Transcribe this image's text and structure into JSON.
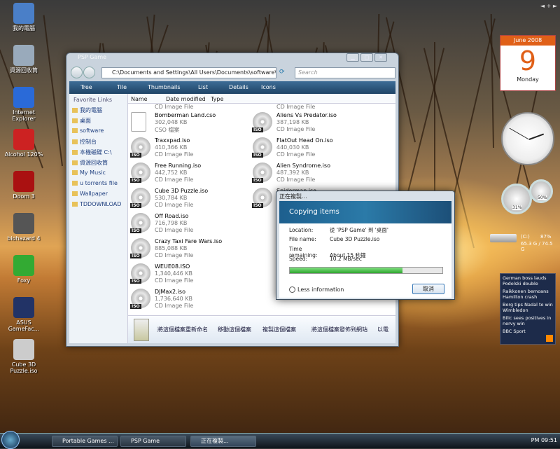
{
  "desktop_icons": [
    {
      "label": "我的電腦",
      "color": "#4a7fc8"
    },
    {
      "label": "資源回收筒",
      "color": "#9ab"
    },
    {
      "label": "Internet Explorer",
      "color": "#2a6ad8"
    },
    {
      "label": "Alcohol 120%",
      "color": "#c22"
    },
    {
      "label": "Doom 3",
      "color": "#a11"
    },
    {
      "label": "biohazard 4",
      "color": "#555"
    },
    {
      "label": "Foxy",
      "color": "#3a3"
    },
    {
      "label": "ASUS GameFac...",
      "color": "#236"
    },
    {
      "label": "Cube 3D Puzzle.iso",
      "color": "#ccc"
    }
  ],
  "window": {
    "title": "PSP Game",
    "path": "C:\\Documents and Settings\\All Users\\Documents\\software\\PSP",
    "search_placeholder": "Search",
    "toolbar": [
      "Tree",
      "Tile",
      "Thumbnails",
      "List",
      "Details",
      "Icons"
    ],
    "favorites_header": "Favorite Links",
    "favorites": [
      "我的電腦",
      "桌面",
      "software",
      "控制台",
      "本機磁碟 C:\\",
      "資源回收筒",
      "My Music",
      "u torrents file",
      "Wallpaper",
      "TDDOWNLOAD"
    ],
    "columns": [
      "Name",
      "Date modified",
      "Type"
    ],
    "left_files": [
      {
        "name": "Bomberman Land.cso",
        "size": "302,048 KB",
        "type": "CSO 檔案"
      },
      {
        "name": "Traxxpad.iso",
        "size": "410,366 KB",
        "type": "CD Image File"
      },
      {
        "name": "Free Running.iso",
        "size": "442,752 KB",
        "type": "CD Image File"
      },
      {
        "name": "Cube 3D Puzzle.iso",
        "size": "530,784 KB",
        "type": "CD Image File"
      },
      {
        "name": "Off Road.iso",
        "size": "716,798 KB",
        "type": "CD Image File"
      },
      {
        "name": "Crazy Taxi Fare Wars.iso",
        "size": "885,088 KB",
        "type": "CD Image File"
      },
      {
        "name": "WEUE08.ISO",
        "size": "1,340,446 KB",
        "type": "CD Image File"
      },
      {
        "name": "DJMax2.iso",
        "size": "1,736,640 KB",
        "type": "CD Image File"
      }
    ],
    "right_files": [
      {
        "name": "Aliens Vs Predator.iso",
        "size": "387,198 KB",
        "type": "CD Image File"
      },
      {
        "name": "FlatOut Head On.iso",
        "size": "440,030 KB",
        "type": "CD Image File"
      },
      {
        "name": "Alien Syndrome.iso",
        "size": "487,392 KB",
        "type": "CD Image File"
      },
      {
        "name": "Spiderman.iso",
        "size": "",
        "type": ""
      }
    ],
    "top_partial_left": "CD Image File",
    "top_partial_right": "CD Image File",
    "footer_actions": [
      "將這個檔案重新命名",
      "移動這個檔案",
      "複製這個檔案",
      "將這個檔案發佈到網站",
      "以電"
    ]
  },
  "copy_dialog": {
    "title": "正在複製...",
    "heading": "Copying items",
    "location_label": "Location:",
    "location": "從 'PSP Game' 到 '桌面'",
    "filename_label": "File name:",
    "filename": "Cube 3D Puzzle.iso",
    "time_label": "Time remaining:",
    "time": "About 15 秒鐘",
    "speed_label": "Speed:",
    "speed": "10.2 MB/sec",
    "progress": 0.74,
    "less_info": "Less information",
    "cancel": "取消"
  },
  "sidebar": {
    "month": "June 2008",
    "day": "9",
    "weekday": "Monday",
    "cpu": "31%",
    "mem": "50%",
    "drive_label": "(C:)",
    "drive_pct": "87%",
    "drive_size": "65.3 G / 74.5 G",
    "news": [
      "German boss lauds Podolski double",
      "Raikkonen bemoans Hamilton crash",
      "Borg tips Nadal to win Wimbledon",
      "Bilic sees positives in nervy win"
    ],
    "news_source": "BBC Sport"
  },
  "taskbar": {
    "tasks": [
      "Portable Games ...",
      "PSP Game",
      "正在複製..."
    ],
    "clock": "PM 09:51"
  }
}
